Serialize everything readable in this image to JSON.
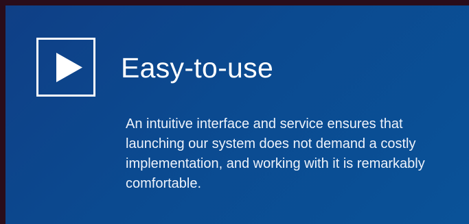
{
  "feature": {
    "icon": "play-icon",
    "title": "Easy-to-use",
    "description": "An intuitive interface and service ensures that launching our system does not demand a costly implementation, and working with it is remarkably comfortable."
  },
  "colors": {
    "page_frame": "#2a0d1a",
    "card_gradient_start": "#0f3f86",
    "card_gradient_end": "#0a5298",
    "text": "#ffffff"
  }
}
